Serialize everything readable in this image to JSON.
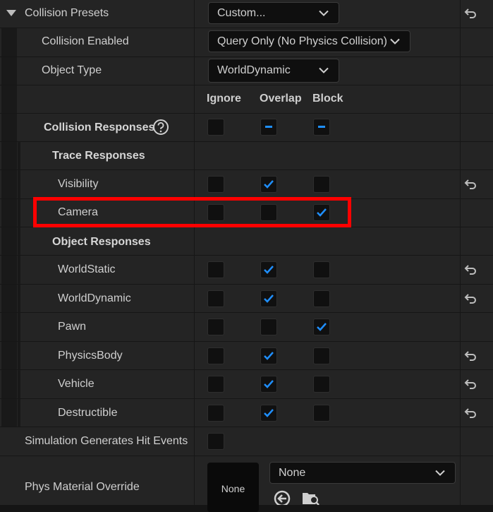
{
  "collision_presets": {
    "label": "Collision Presets",
    "value": "Custom..."
  },
  "collision_enabled": {
    "label": "Collision Enabled",
    "value": "Query Only (No Physics Collision)"
  },
  "object_type": {
    "label": "Object Type",
    "value": "WorldDynamic"
  },
  "columns": {
    "ignore": "Ignore",
    "overlap": "Overlap",
    "block": "Block"
  },
  "collision_responses": {
    "label": "Collision Responses",
    "help_icon": "question-circle-icon"
  },
  "trace_responses": {
    "label": "Trace Responses",
    "items": [
      {
        "label": "Visibility",
        "ignore": false,
        "overlap": true,
        "block": false,
        "reset": true
      },
      {
        "label": "Camera",
        "ignore": false,
        "overlap": false,
        "block": true,
        "reset": false
      }
    ]
  },
  "object_responses": {
    "label": "Object Responses",
    "items": [
      {
        "label": "WorldStatic",
        "ignore": false,
        "overlap": true,
        "block": false,
        "reset": true
      },
      {
        "label": "WorldDynamic",
        "ignore": false,
        "overlap": true,
        "block": false,
        "reset": true
      },
      {
        "label": "Pawn",
        "ignore": false,
        "overlap": false,
        "block": true,
        "reset": false
      },
      {
        "label": "PhysicsBody",
        "ignore": false,
        "overlap": true,
        "block": false,
        "reset": true
      },
      {
        "label": "Vehicle",
        "ignore": false,
        "overlap": true,
        "block": false,
        "reset": true
      },
      {
        "label": "Destructible",
        "ignore": false,
        "overlap": true,
        "block": false,
        "reset": true
      }
    ]
  },
  "sim_hit_events": {
    "label": "Simulation Generates Hit Events",
    "checked": false
  },
  "phys_material": {
    "label": "Phys Material Override",
    "thumb_text": "None",
    "value": "None"
  },
  "colors": {
    "accent": "#1f8fff",
    "highlight": "#ff0000",
    "panel": "#242424"
  }
}
